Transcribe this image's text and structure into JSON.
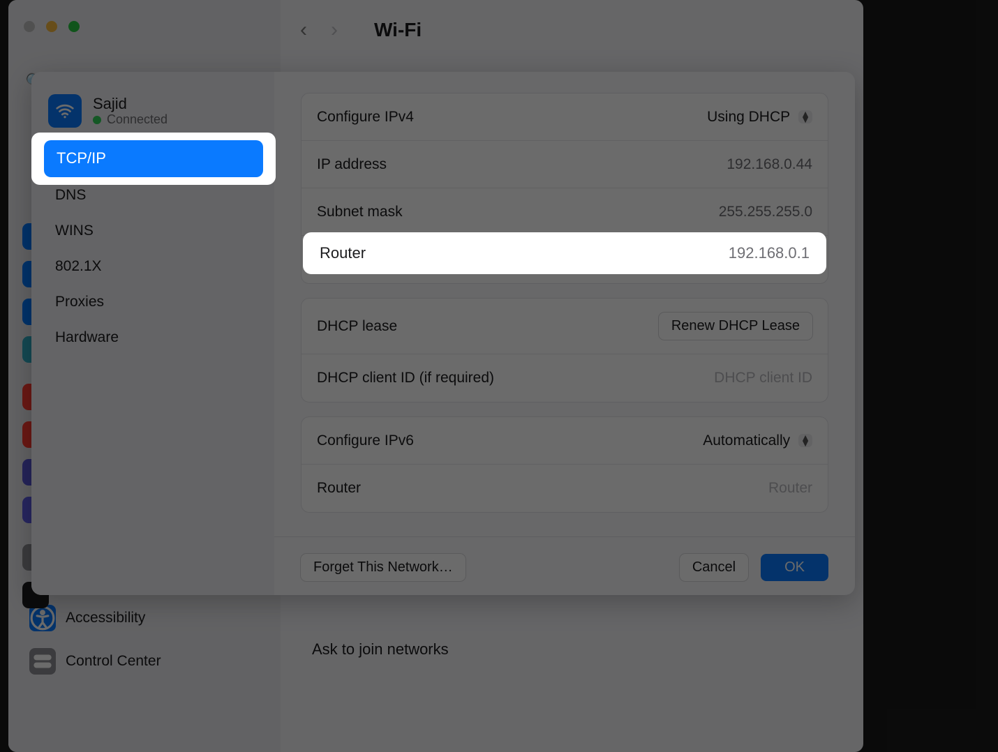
{
  "header": {
    "title": "Wi-Fi"
  },
  "network": {
    "name": "Sajid",
    "status": "Connected"
  },
  "tabs": [
    "TCP/IP",
    "DNS",
    "WINS",
    "802.1X",
    "Proxies",
    "Hardware"
  ],
  "ipv4": {
    "configure_label": "Configure IPv4",
    "configure_value": "Using DHCP",
    "ip_label": "IP address",
    "ip_value": "192.168.0.44",
    "mask_label": "Subnet mask",
    "mask_value": "255.255.255.0",
    "router_label": "Router",
    "router_value": "192.168.0.1"
  },
  "dhcp": {
    "lease_label": "DHCP lease",
    "renew_label": "Renew DHCP Lease",
    "client_label": "DHCP client ID (if required)",
    "client_placeholder": "DHCP client ID"
  },
  "ipv6": {
    "configure_label": "Configure IPv6",
    "configure_value": "Automatically",
    "router_label": "Router",
    "router_placeholder": "Router"
  },
  "footer": {
    "forget": "Forget This Network…",
    "cancel": "Cancel",
    "ok": "OK"
  },
  "bg_sidebar": {
    "accessibility": "Accessibility",
    "control_center": "Control Center",
    "ask": "Ask to join networks"
  },
  "peek_colors": [
    "#007aff",
    "#007aff",
    "#007aff",
    "#30b0c7",
    "#ff3b30",
    "#ff3b30",
    "#5856d6",
    "#5e5ce6",
    "#8e8e93",
    "#1c1c1e"
  ]
}
